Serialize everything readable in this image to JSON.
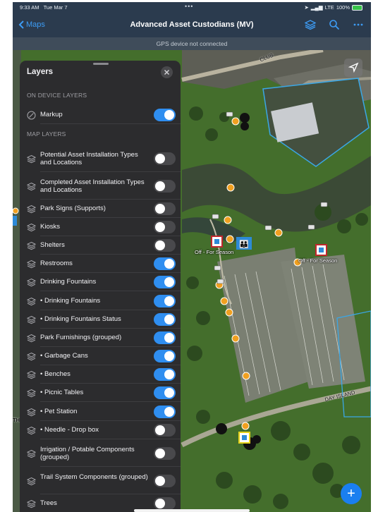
{
  "status_bar": {
    "time": "9:33 AM",
    "date": "Tue Mar 7",
    "dots": "•••",
    "carrier": "LTE",
    "battery": "100%"
  },
  "nav": {
    "back_label": "Maps",
    "title": "Advanced Asset Custodians (MV)"
  },
  "gps_banner": "GPS device not connected",
  "layers_panel": {
    "title": "Layers",
    "on_device_header": "ON DEVICE LAYERS",
    "map_layers_header": "MAP LAYERS",
    "device_layers": [
      {
        "label": "Markup",
        "on": true
      }
    ],
    "map_layers": [
      {
        "label": "Potential Asset Installation Types and Locations",
        "on": false
      },
      {
        "label": "Completed Asset Installation Types and Locations",
        "on": false
      },
      {
        "label": "Park Signs (Supports)",
        "on": false
      },
      {
        "label": "Kiosks",
        "on": false
      },
      {
        "label": "Shelters",
        "on": false
      },
      {
        "label": "Restrooms",
        "on": true
      },
      {
        "label": "Drinking Fountains",
        "on": true
      },
      {
        "label": "• Drinking Fountains",
        "on": true
      },
      {
        "label": "• Drinking Fountains Status",
        "on": true
      },
      {
        "label": "Park Furnishings (grouped)",
        "on": true
      },
      {
        "label": "• Garbage Cans",
        "on": true
      },
      {
        "label": "• Benches",
        "on": true
      },
      {
        "label": "• Picnic Tables",
        "on": true
      },
      {
        "label": "• Pet Station",
        "on": true
      },
      {
        "label": "• Needle - Drop box",
        "on": false
      },
      {
        "label": "Irrigation / Potable Components (grouped)",
        "on": false
      },
      {
        "label": "Trail System Components (grouped)",
        "on": false
      },
      {
        "label": "Trees",
        "on": false
      }
    ]
  },
  "map": {
    "labels": {
      "club": "CLUB",
      "day_island": "DAY ISLAND",
      "off_season_1": "Off - For Season",
      "off_season_2": "Off - For Season",
      "edge_th": "TH"
    }
  },
  "fab_label": "+",
  "colors": {
    "accent": "#2f8ef0",
    "panel_bg": "#2c2c2e",
    "nav_bg": "#2b3b4e",
    "toggle_off": "#49494c"
  },
  "icons": [
    "layers-icon",
    "search-icon",
    "more-icon",
    "close-icon",
    "locate-icon",
    "markup-icon",
    "stack-icon"
  ]
}
